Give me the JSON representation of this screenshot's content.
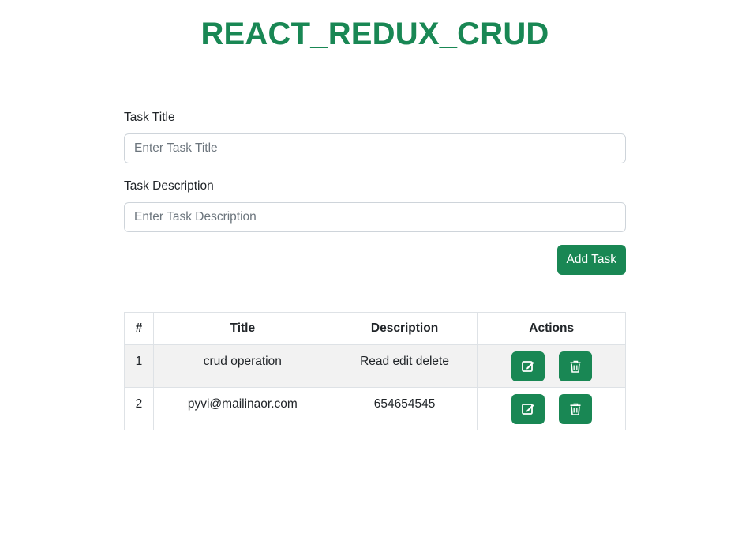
{
  "header": {
    "title": "REACT_REDUX_CRUD"
  },
  "form": {
    "title_label": "Task Title",
    "title_placeholder": "Enter Task Title",
    "title_value": "",
    "description_label": "Task Description",
    "description_placeholder": "Enter Task Description",
    "description_value": "",
    "add_button_label": "Add Task"
  },
  "table": {
    "headers": [
      "#",
      "Title",
      "Description",
      "Actions"
    ],
    "rows": [
      {
        "num": "1",
        "title": "crud operation",
        "description": "Read edit delete"
      },
      {
        "num": "2",
        "title": "pyvi@mailinaor.com",
        "description": "654654545"
      }
    ],
    "edit_icon": "edit-icon",
    "delete_icon": "trash-icon"
  },
  "colors": {
    "accent": "#198754",
    "stripe": "#f2f2f2",
    "border": "#dee2e6"
  }
}
